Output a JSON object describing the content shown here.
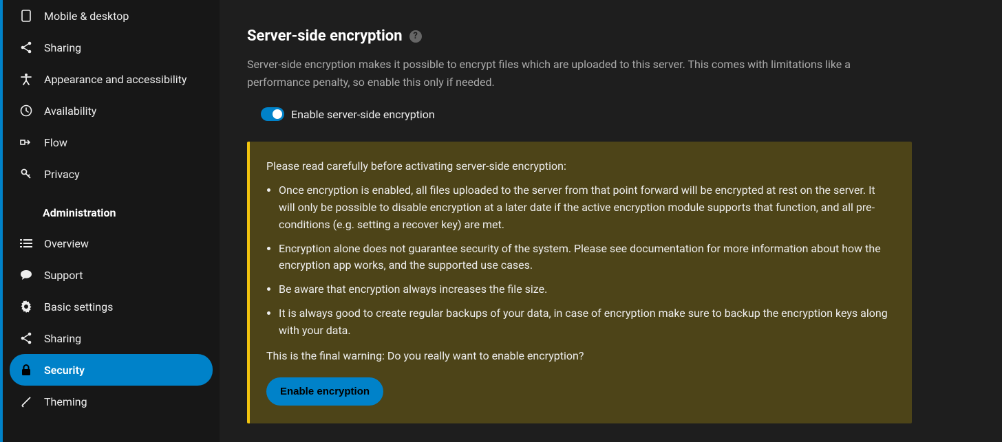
{
  "sidebar": {
    "items": [
      {
        "label": "Mobile & desktop"
      },
      {
        "label": "Sharing"
      },
      {
        "label": "Appearance and accessibility"
      },
      {
        "label": "Availability"
      },
      {
        "label": "Flow"
      },
      {
        "label": "Privacy"
      }
    ],
    "section_heading": "Administration",
    "admin_items": [
      {
        "label": "Overview"
      },
      {
        "label": "Support"
      },
      {
        "label": "Basic settings"
      },
      {
        "label": "Sharing"
      },
      {
        "label": "Security"
      },
      {
        "label": "Theming"
      }
    ]
  },
  "main": {
    "title": "Server-side encryption",
    "description": "Server-side encryption makes it possible to encrypt files which are uploaded to this server. This comes with limitations like a performance penalty, so enable this only if needed.",
    "toggle_label": "Enable server-side encryption",
    "warning": {
      "intro": "Please read carefully before activating server-side encryption:",
      "points": [
        "Once encryption is enabled, all files uploaded to the server from that point forward will be encrypted at rest on the server. It will only be possible to disable encryption at a later date if the active encryption module supports that function, and all pre-conditions (e.g. setting a recover key) are met.",
        "Encryption alone does not guarantee security of the system. Please see documentation for more information about how the encryption app works, and the supported use cases.",
        "Be aware that encryption always increases the file size.",
        "It is always good to create regular backups of your data, in case of encryption make sure to backup the encryption keys along with your data."
      ],
      "final": "This is the final warning: Do you really want to enable encryption?",
      "button": "Enable encryption"
    }
  }
}
